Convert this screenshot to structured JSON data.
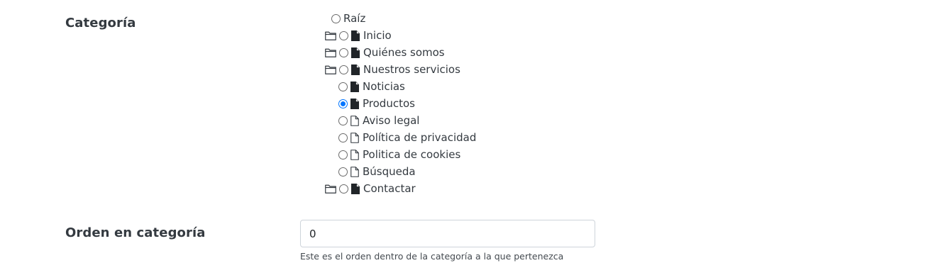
{
  "categoria": {
    "label": "Categoría",
    "selected": "Productos",
    "items": [
      {
        "label": "Raíz",
        "folder": false,
        "file": "none",
        "checked": false
      },
      {
        "label": "Inicio",
        "folder": true,
        "file": "solid",
        "checked": false
      },
      {
        "label": "Quiénes somos",
        "folder": true,
        "file": "solid",
        "checked": false
      },
      {
        "label": "Nuestros servicios",
        "folder": true,
        "file": "solid",
        "checked": false
      },
      {
        "label": "Noticias",
        "folder": false,
        "file": "solid",
        "checked": false
      },
      {
        "label": "Productos",
        "folder": false,
        "file": "solid",
        "checked": true
      },
      {
        "label": "Aviso legal",
        "folder": false,
        "file": "outline",
        "checked": false
      },
      {
        "label": "Política de privacidad",
        "folder": false,
        "file": "outline",
        "checked": false
      },
      {
        "label": "Politica de cookies",
        "folder": false,
        "file": "outline",
        "checked": false
      },
      {
        "label": "Búsqueda",
        "folder": false,
        "file": "outline",
        "checked": false
      },
      {
        "label": "Contactar",
        "folder": true,
        "file": "solid",
        "checked": false
      }
    ]
  },
  "orden": {
    "label": "Orden en categoría",
    "value": "0",
    "help": "Este es el orden dentro de la categoría a la que pertenezca"
  },
  "colors": {
    "radio_checked": "#0075ff",
    "label_text": "#343a40",
    "input_border": "#ced4da"
  }
}
